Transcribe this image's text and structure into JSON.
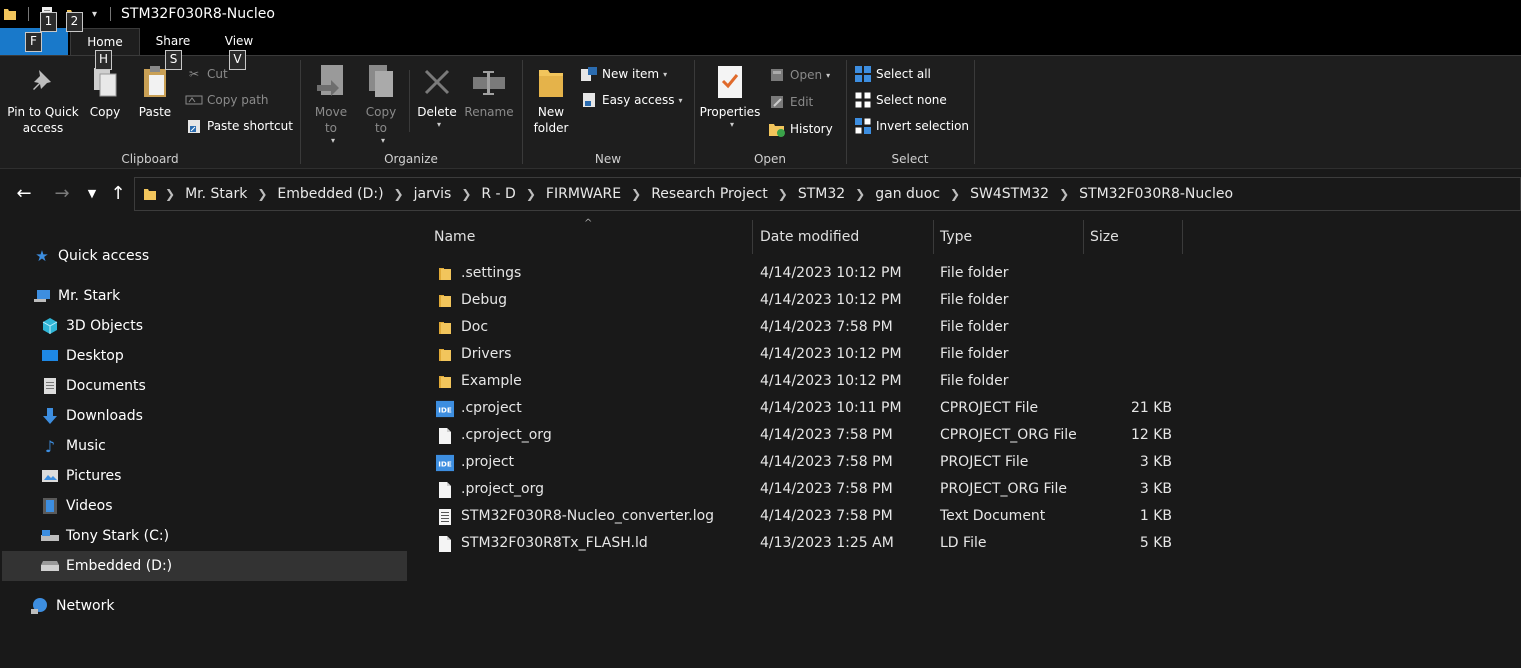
{
  "titlebar": {
    "title": "STM32F030R8-Nucleo",
    "keytips": {
      "qat1": "1",
      "qat2": "2",
      "file": "F",
      "home": "H",
      "share": "S",
      "view": "V"
    }
  },
  "tabs": {
    "home": "Home",
    "share": "Share",
    "view": "View"
  },
  "ribbon": {
    "clipboard": {
      "label": "Clipboard",
      "pin": "Pin to Quick access",
      "copy": "Copy",
      "paste": "Paste",
      "cut": "Cut",
      "copy_path": "Copy path",
      "paste_shortcut": "Paste shortcut"
    },
    "organize": {
      "label": "Organize",
      "move_to": "Move to",
      "copy_to": "Copy to",
      "delete": "Delete",
      "rename": "Rename"
    },
    "new": {
      "label": "New",
      "new_folder": "New folder",
      "new_item": "New item",
      "easy_access": "Easy access"
    },
    "open": {
      "label": "Open",
      "properties": "Properties",
      "open": "Open",
      "edit": "Edit",
      "history": "History"
    },
    "select": {
      "label": "Select",
      "select_all": "Select all",
      "select_none": "Select none",
      "invert_selection": "Invert selection"
    }
  },
  "breadcrumb": [
    "Mr. Stark",
    "Embedded (D:)",
    "jarvis",
    "R - D",
    "FIRMWARE",
    "Research Project",
    "STM32",
    "gan duoc",
    "SW4STM32",
    "STM32F030R8-Nucleo"
  ],
  "navpane": {
    "quick_access": "Quick access",
    "this_pc": "Mr. Stark",
    "objects3d": "3D Objects",
    "desktop": "Desktop",
    "documents": "Documents",
    "downloads": "Downloads",
    "music": "Music",
    "pictures": "Pictures",
    "videos": "Videos",
    "drive_c": "Tony Stark (C:)",
    "drive_d": "Embedded (D:)",
    "network": "Network"
  },
  "columns": {
    "name": "Name",
    "date": "Date modified",
    "type": "Type",
    "size": "Size"
  },
  "files": [
    {
      "name": ".settings",
      "date": "4/14/2023 10:12 PM",
      "type": "File folder",
      "size": "",
      "icon": "folder-icon"
    },
    {
      "name": "Debug",
      "date": "4/14/2023 10:12 PM",
      "type": "File folder",
      "size": "",
      "icon": "folder-icon"
    },
    {
      "name": "Doc",
      "date": "4/14/2023 7:58 PM",
      "type": "File folder",
      "size": "",
      "icon": "folder-icon"
    },
    {
      "name": "Drivers",
      "date": "4/14/2023 10:12 PM",
      "type": "File folder",
      "size": "",
      "icon": "folder-icon"
    },
    {
      "name": "Example",
      "date": "4/14/2023 10:12 PM",
      "type": "File folder",
      "size": "",
      "icon": "folder-icon"
    },
    {
      "name": ".cproject",
      "date": "4/14/2023 10:11 PM",
      "type": "CPROJECT File",
      "size": "21 KB",
      "icon": "ide-icon"
    },
    {
      "name": ".cproject_org",
      "date": "4/14/2023 7:58 PM",
      "type": "CPROJECT_ORG File",
      "size": "12 KB",
      "icon": "blank-file-icon"
    },
    {
      "name": ".project",
      "date": "4/14/2023 7:58 PM",
      "type": "PROJECT File",
      "size": "3 KB",
      "icon": "ide-icon"
    },
    {
      "name": ".project_org",
      "date": "4/14/2023 7:58 PM",
      "type": "PROJECT_ORG File",
      "size": "3 KB",
      "icon": "blank-file-icon"
    },
    {
      "name": "STM32F030R8-Nucleo_converter.log",
      "date": "4/14/2023 7:58 PM",
      "type": "Text Document",
      "size": "1 KB",
      "icon": "text-file-icon"
    },
    {
      "name": "STM32F030R8Tx_FLASH.ld",
      "date": "4/13/2023 1:25 AM",
      "type": "LD File",
      "size": "5 KB",
      "icon": "blank-file-icon"
    }
  ],
  "colors": {
    "accent": "#1979ca",
    "background": "#191919",
    "ribbon": "#1e1e1e",
    "folder": "#f2c55c",
    "selected": "#333333"
  }
}
